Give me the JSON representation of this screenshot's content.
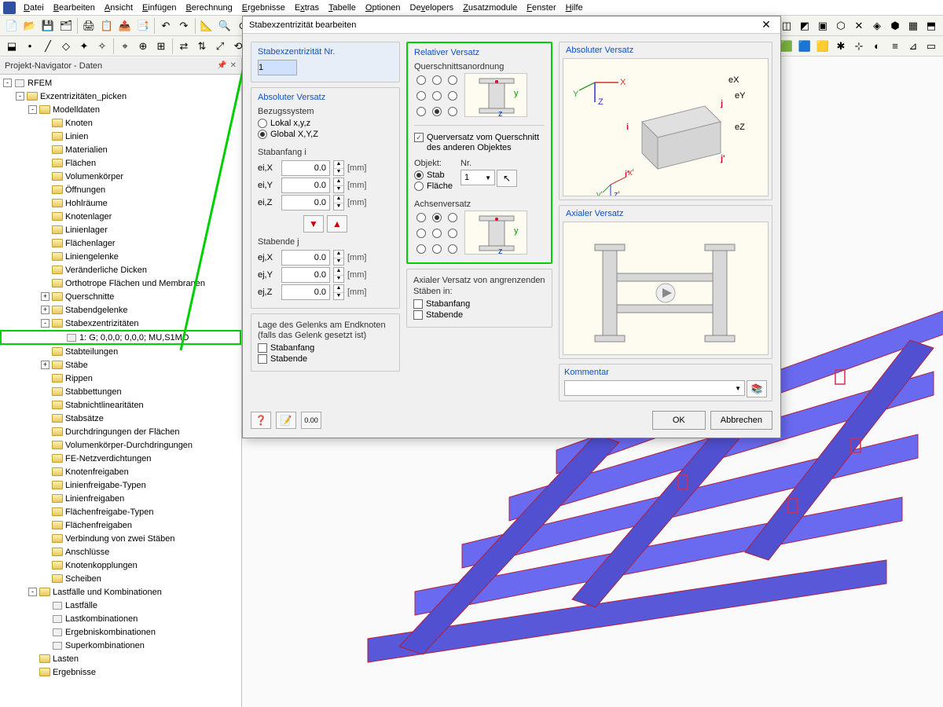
{
  "menu": [
    "Datei",
    "Bearbeiten",
    "Ansicht",
    "Einfügen",
    "Berechnung",
    "Ergebnisse",
    "Extras",
    "Tabelle",
    "Optionen",
    "Developers",
    "Zusatzmodule",
    "Fenster",
    "Hilfe"
  ],
  "navigator": {
    "title": "Projekt-Navigator - Daten",
    "root": "RFEM",
    "project": "Exzentrizitäten_picken",
    "modeldata": "Modelldaten",
    "items1": [
      "Knoten",
      "Linien",
      "Materialien",
      "Flächen",
      "Volumenkörper",
      "Öffnungen",
      "Hohlräume",
      "Knotenlager",
      "Linienlager",
      "Flächenlager",
      "Liniengelenke",
      "Veränderliche Dicken",
      "Orthotrope Flächen und Membranen",
      "Querschnitte",
      "Stabendgelenke",
      "Stabexzentrizitäten"
    ],
    "selected_item": "1: G; 0,0,0; 0,0,0; MU,S1MO",
    "items2": [
      "Stabteilungen",
      "Stäbe",
      "Rippen",
      "Stabbettungen",
      "Stabnichtlinearitäten",
      "Stabsätze",
      "Durchdringungen der Flächen",
      "Volumenkörper-Durchdringungen",
      "FE-Netzverdichtungen",
      "Knotenfreigaben",
      "Linienfreigabe-Typen",
      "Linienfreigaben",
      "Flächenfreigabe-Typen",
      "Flächenfreigaben",
      "Verbindung von zwei Stäben",
      "Anschlüsse",
      "Knotenkopplungen",
      "Scheiben"
    ],
    "loads_group": "Lastfälle und Kombinationen",
    "loads_items": [
      "Lastfälle",
      "Lastkombinationen",
      "Ergebniskombinationen",
      "Superkombinationen"
    ],
    "lasten": "Lasten",
    "ergebnisse": "Ergebnisse"
  },
  "dialog": {
    "title": "Stabexzentrizität bearbeiten",
    "nr_label": "Stabexzentrizität Nr.",
    "nr_value": "1",
    "abs_offset": "Absoluter Versatz",
    "ref_system": "Bezugssystem",
    "local": "Lokal x,y,z",
    "global": "Global X,Y,Z",
    "stab_i": "Stabanfang i",
    "stab_j": "Stabende j",
    "eix": "ei,X",
    "eiy": "ei,Y",
    "eiz": "ei,Z",
    "ejx": "ej,X",
    "ejy": "ej,Y",
    "ejz": "ej,Z",
    "val": "0.0",
    "mm": "[mm]",
    "hinge_label": "Lage des Gelenks am Endknoten (falls das Gelenk gesetzt ist)",
    "stabanfang": "Stabanfang",
    "stabende": "Stabende",
    "rel_offset": "Relativer Versatz",
    "cross_arr": "Querschnittsanordnung",
    "transverse": "Querversatz vom Querschnitt des anderen Objektes",
    "object": "Objekt:",
    "nr": "Nr.",
    "stab": "Stab",
    "flaeche": "Fläche",
    "obj_nr": "1",
    "axis_offset": "Achsenversatz",
    "axial_offset": "Axialer Versatz",
    "axial_adj": "Axialer Versatz von angrenzenden Stäben in:",
    "kommentar": "Kommentar",
    "ok": "OK",
    "cancel": "Abbrechen"
  }
}
